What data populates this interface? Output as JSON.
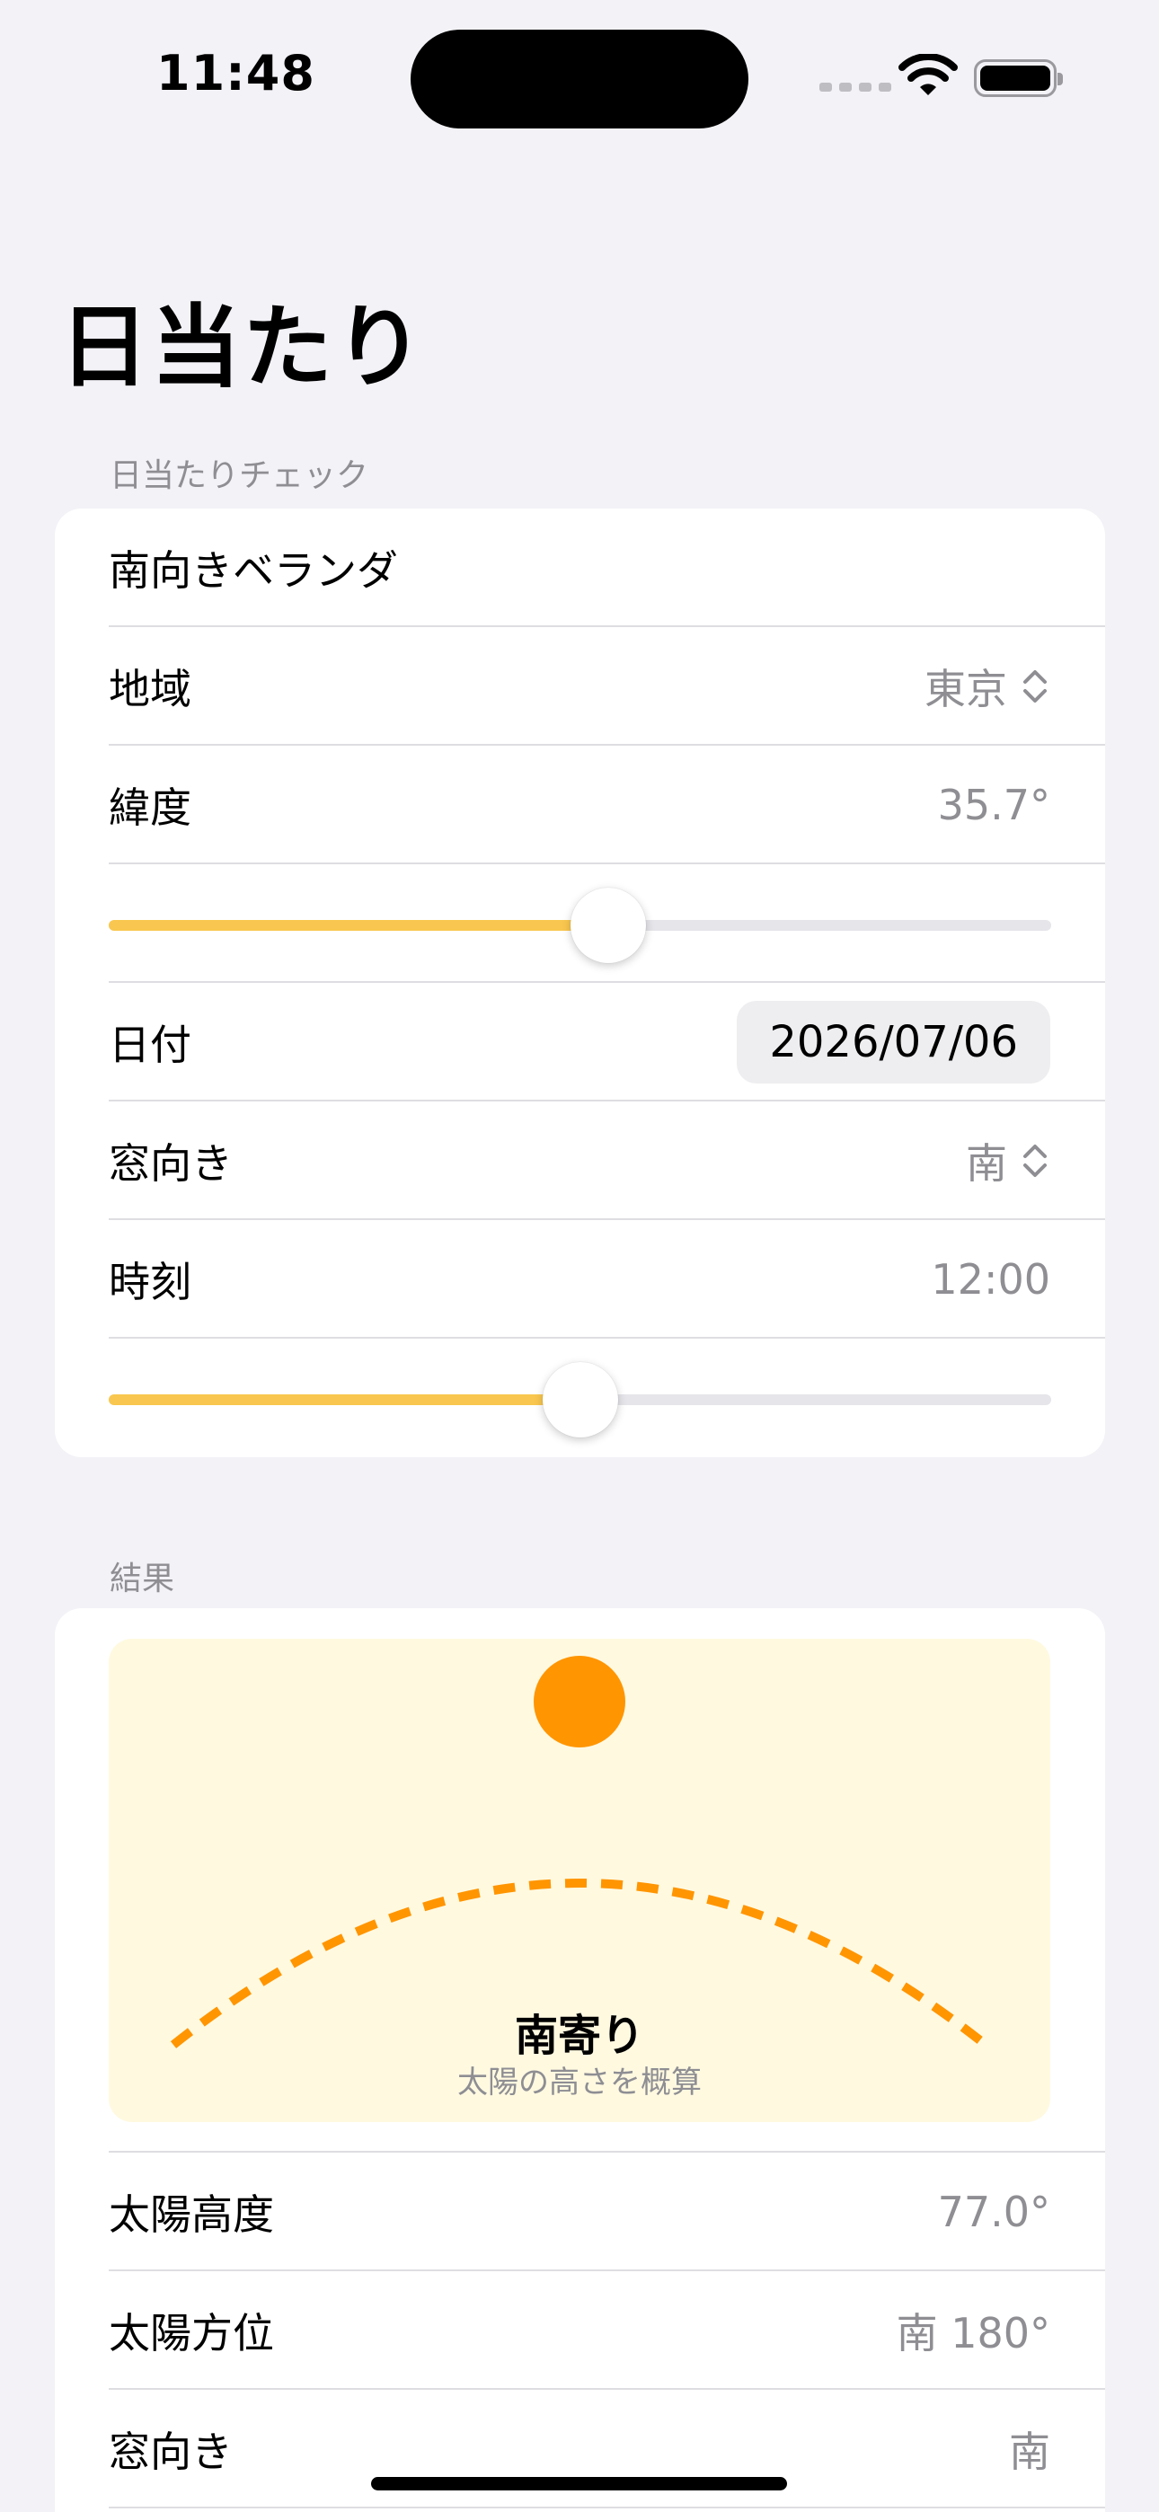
{
  "status": {
    "time": "11:48"
  },
  "title": "日当たり",
  "check_section": {
    "header": "日当たりチェック",
    "name_field": "南向きベランダ",
    "region": {
      "label": "地域",
      "value": "東京"
    },
    "latitude": {
      "label": "緯度",
      "value": "35.7°",
      "slider_fraction": 0.53
    },
    "date": {
      "label": "日付",
      "value": "2026/07/06"
    },
    "window_direction": {
      "label": "窓向き",
      "value": "南"
    },
    "time": {
      "label": "時刻",
      "value": "12:00",
      "slider_fraction": 0.5
    }
  },
  "result_section": {
    "header": "結果",
    "graphic": {
      "title": "南寄り",
      "subtitle": "太陽の高さを概算"
    },
    "rows": [
      {
        "label": "太陽高度",
        "value": "77.0°"
      },
      {
        "label": "太陽方位",
        "value": "南 180°"
      },
      {
        "label": "窓向き",
        "value": "南"
      }
    ]
  },
  "colors": {
    "accent": "#F9C74F",
    "sun": "#FF9500",
    "panel_bg": "#FFF9E0",
    "background": "#F2F2F7"
  }
}
